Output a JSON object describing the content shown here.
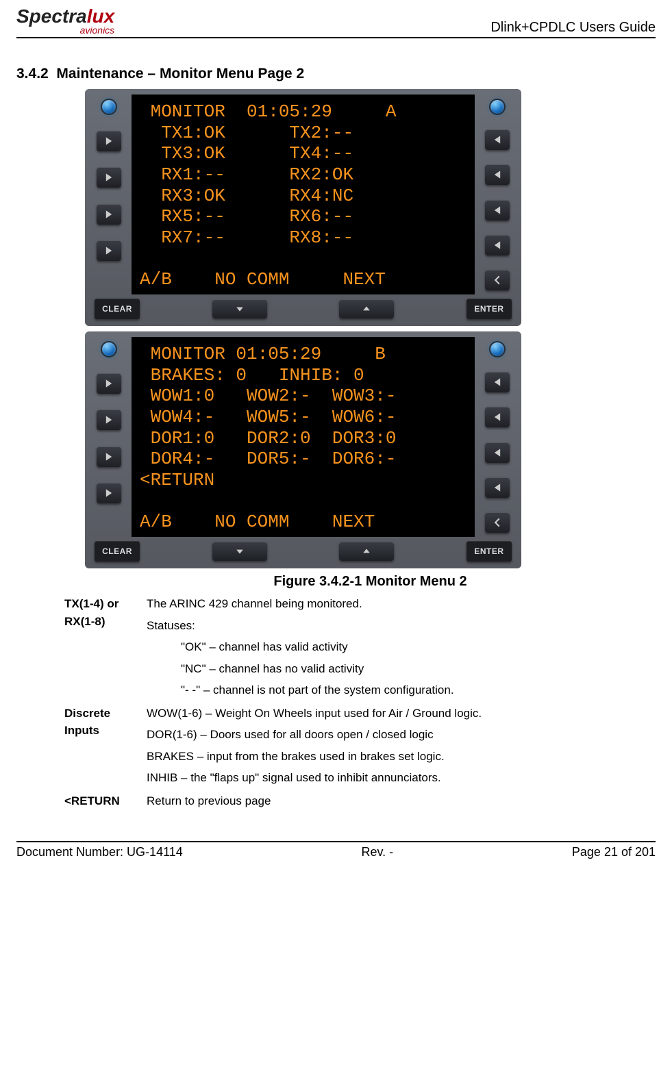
{
  "header": {
    "logo_main1": "Spectra",
    "logo_main2": "lux",
    "logo_sub": "avionics",
    "guide": "Dlink+CPDLC Users Guide"
  },
  "section": {
    "number": "3.4.2",
    "title": "Maintenance – Monitor Menu Page 2"
  },
  "panelA": {
    "line1": " MONITOR  01:05:29     A",
    "line2": "  TX1:OK      TX2:--",
    "line3": "  TX3:OK      TX4:--",
    "line4": "  RX1:--      RX2:OK",
    "line5": "  RX3:OK      RX4:NC",
    "line6": "  RX5:--      RX6:--",
    "line7": "  RX7:--      RX8:--",
    "line8": "",
    "line9": "A/B    NO COMM     NEXT",
    "clear": "CLEAR",
    "enter": "ENTER"
  },
  "panelB": {
    "line1": " MONITOR 01:05:29     B",
    "line2": " BRAKES: 0   INHIB: 0",
    "line3": " WOW1:0   WOW2:-  WOW3:-",
    "line4": " WOW4:-   WOW5:-  WOW6:-",
    "line5": " DOR1:0   DOR2:0  DOR3:0",
    "line6": " DOR4:-   DOR5:-  DOR6:-",
    "line7": "<RETURN",
    "line8": "",
    "line9": "A/B    NO COMM    NEXT",
    "clear": "CLEAR",
    "enter": "ENTER"
  },
  "figure_caption": "Figure 3.4.2-1 Monitor Menu 2",
  "desc": {
    "r1_term": "TX(1-4) or RX(1-8)",
    "r1_p1": "The ARINC 429 channel being monitored.",
    "r1_p2": "Statuses:",
    "r1_p3": "\"OK\" – channel has valid activity",
    "r1_p4": "\"NC\" – channel has no valid activity",
    "r1_p5": "\"- -\" –  channel is not part of the system configuration.",
    "r2_term": "Discrete Inputs",
    "r2_p1": "WOW(1-6) – Weight On Wheels input used for Air / Ground logic.",
    "r2_p2": "DOR(1-6) – Doors used for all doors open / closed logic",
    "r2_p3": "BRAKES – input from the brakes used in brakes set logic.",
    "r2_p4": "INHIB – the \"flaps up\" signal used to inhibit annunciators.",
    "r3_term": "<RETURN",
    "r3_p1": "Return to previous page"
  },
  "footer": {
    "left": "Document Number:  UG-14114",
    "mid": "Rev. -",
    "right": "Page 21 of 201"
  }
}
